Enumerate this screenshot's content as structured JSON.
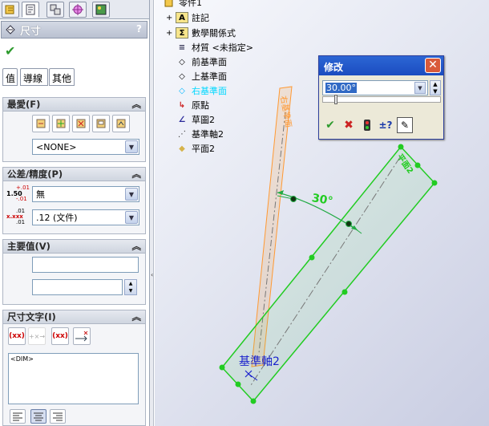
{
  "panel": {
    "title": "尺寸",
    "help": "?",
    "ok": "✔",
    "tabs": [
      "值",
      "導線",
      "其他"
    ]
  },
  "favorites": {
    "header": "最愛(F)",
    "collapse": "︽",
    "selected": "<NONE>"
  },
  "tolerance": {
    "header": "公差/精度(P)",
    "collapse": "︽",
    "tol_value": "無",
    "precision_value": ".12 (文件)",
    "tol_icon_top": "+.01",
    "tol_icon_main": "1.50",
    "tol_icon_bottom": "-.01",
    "prec_icon_top": ".01",
    "prec_icon_main": "x.xxx",
    "prec_icon_bottom": ".01"
  },
  "primary": {
    "header": "主要值(V)",
    "collapse": "︽",
    "name_value": "",
    "value_value": ""
  },
  "dimtext": {
    "header": "尺寸文字(I)",
    "collapse": "︽",
    "text": "<DIM>",
    "btn1": "(xx)",
    "btn2": "+×→",
    "btn3": "(xx)"
  },
  "tree": {
    "root": "零件1",
    "items": [
      {
        "label": "註記",
        "icon": "A",
        "expand": "+"
      },
      {
        "label": "數學關係式",
        "icon": "Σ",
        "expand": "+"
      },
      {
        "label": "材質 <未指定>",
        "icon": "≡",
        "expand": ""
      },
      {
        "label": "前基準面",
        "icon": "◇",
        "expand": ""
      },
      {
        "label": "上基準面",
        "icon": "◇",
        "expand": ""
      },
      {
        "label": "右基準面",
        "icon": "◇",
        "expand": ""
      },
      {
        "label": "原點",
        "icon": "↳",
        "expand": ""
      },
      {
        "label": "草圖2",
        "icon": "∠",
        "expand": ""
      },
      {
        "label": "基準軸2",
        "icon": "⋰",
        "expand": ""
      },
      {
        "label": "平面2",
        "icon": "◆",
        "expand": ""
      }
    ],
    "highlight_color": "#00d8ff"
  },
  "dialog": {
    "title": "修改",
    "close": "✕",
    "value": "30.00°",
    "ok": "✔",
    "cancel": "✖",
    "rebuild": "🚦",
    "dims": "±?",
    "mark": "✎"
  },
  "graphics": {
    "orange_plane_label": "右基準面",
    "green_plane_label": "平面2",
    "angle_label": "30°",
    "axis_label": "基準軸2",
    "green": "#22cc22",
    "orange": "#ff9933",
    "blue": "#1a22cc"
  }
}
